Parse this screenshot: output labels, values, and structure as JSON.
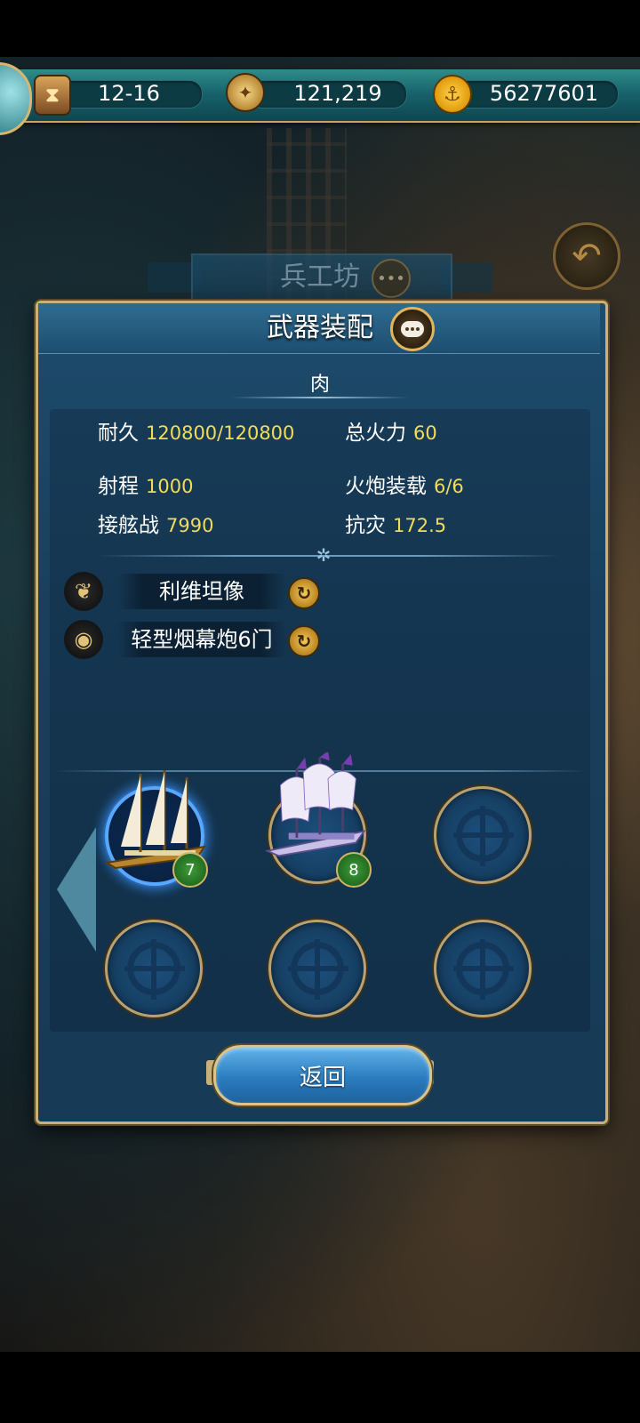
{
  "topbar": {
    "date": "12-16",
    "compass_value": "121,219",
    "gold_value": "56277601",
    "icons": [
      "hourglass-icon",
      "compass-icon",
      "anchor-icon"
    ]
  },
  "background": {
    "header_title": "兵工坊"
  },
  "dialog": {
    "title": "武器装配",
    "ship_name": "肉",
    "stats": {
      "durability_label": "耐久",
      "durability_value": "120800/120800",
      "firepower_label": "总火力",
      "firepower_value": "60",
      "range_label": "射程",
      "range_value": "1000",
      "cannon_label": "火炮装载",
      "cannon_value": "6/6",
      "boarding_label": "接舷战",
      "boarding_value": "7990",
      "disaster_label": "抗灾",
      "disaster_value": "172.5"
    },
    "equipment": [
      {
        "icon": "wing-icon",
        "label": "利维坦像"
      },
      {
        "icon": "cannon-icon",
        "label": "轻型烟幕炮6门"
      }
    ],
    "ships": [
      {
        "level": "7",
        "selected": true
      },
      {
        "level": "8",
        "selected": false
      }
    ],
    "return_label": "返回"
  },
  "colors": {
    "accent_gold": "#c9b27a",
    "stat_value": "#f2dc5b",
    "panel_blue": "#1e4b6c",
    "selected_glow": "#59a8ff"
  }
}
